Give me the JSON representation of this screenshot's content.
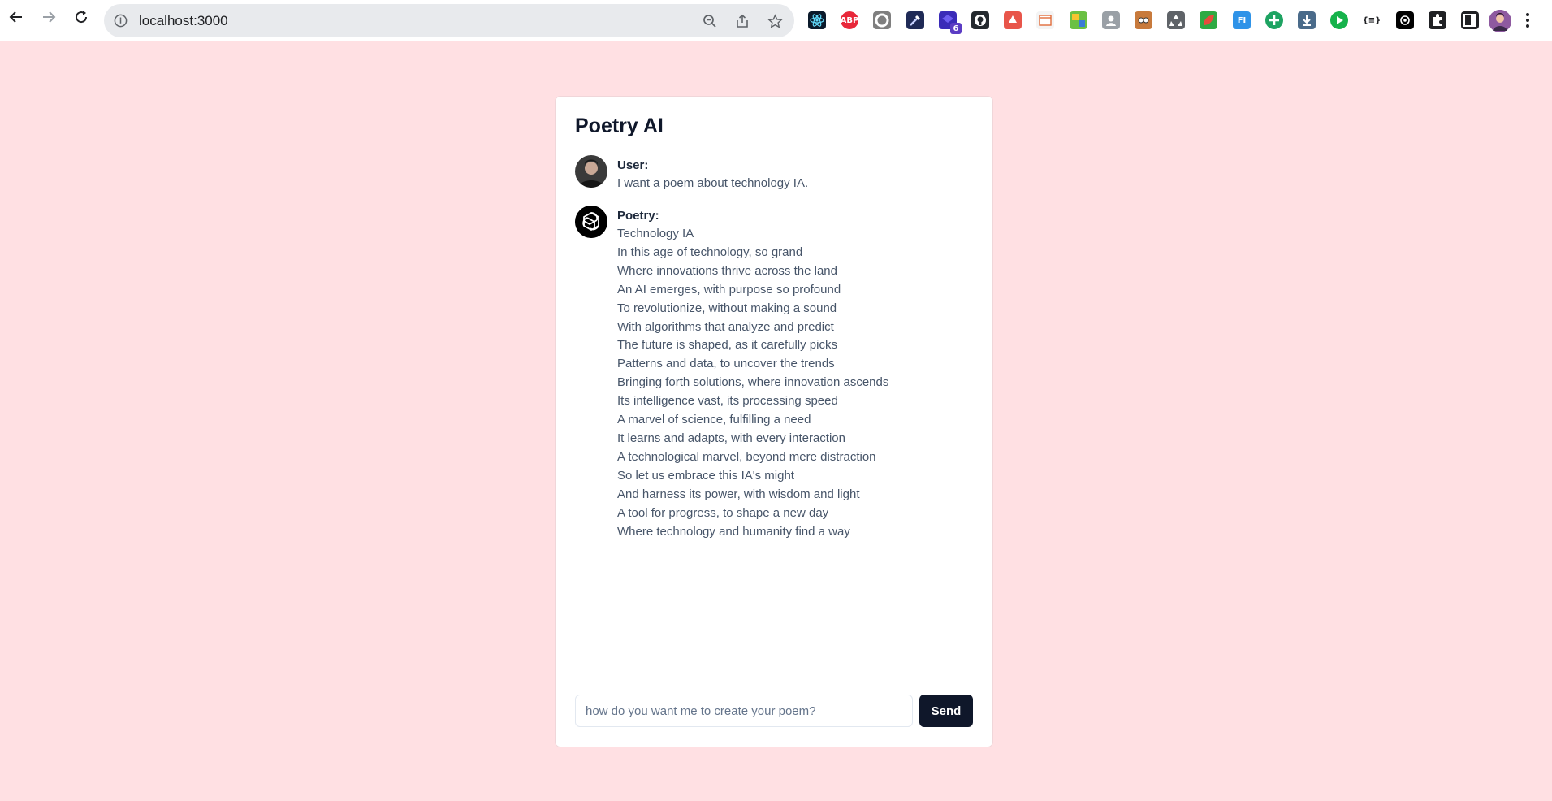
{
  "browser": {
    "url": "localhost:3000",
    "extension_badge": "6",
    "extensions": [
      {
        "name": "react-devtools-icon",
        "color": "#0b1a2b"
      },
      {
        "name": "adblock-icon",
        "color": "#e8273a",
        "label": "ABP"
      },
      {
        "name": "circle-extension-icon",
        "color": "#7f7f7f"
      },
      {
        "name": "eyedropper-icon",
        "color": "#1f2a56"
      },
      {
        "name": "extension-stack-icon",
        "color": "#3a2bb8"
      },
      {
        "name": "github-icon",
        "color": "#24292e"
      },
      {
        "name": "tree-extension-icon",
        "color": "#e8554a"
      },
      {
        "name": "notes-extension-icon",
        "color": "#f4f4f4"
      },
      {
        "name": "colorzilla-icon",
        "color": "#6ac043"
      },
      {
        "name": "photo-extension-icon",
        "color": "#9aa0a6"
      },
      {
        "name": "face-extension-icon",
        "color": "#c87a3c"
      },
      {
        "name": "recycle-icon",
        "color": "#5f6368"
      },
      {
        "name": "leaf-extension-icon",
        "color": "#2eaa43"
      },
      {
        "name": "fi-extension-icon",
        "color": "#2f93e8",
        "label": "FI"
      },
      {
        "name": "plus-extension-icon",
        "color": "#1ea362"
      },
      {
        "name": "download-extension-icon",
        "color": "#4a6b8a"
      },
      {
        "name": "play-extension-icon",
        "color": "#16b24b"
      },
      {
        "name": "json-extension-icon",
        "color": "#ffffff",
        "label": "{≡}"
      },
      {
        "name": "chatgpt-extension-icon",
        "color": "#000000"
      },
      {
        "name": "puzzle-icon",
        "color": "#202124"
      },
      {
        "name": "sidepanel-icon",
        "color": "#202124"
      }
    ]
  },
  "app": {
    "title": "Poetry AI",
    "messages": [
      {
        "speaker": "User:",
        "text": "I want a poem about technology IA."
      },
      {
        "speaker": "Poetry:",
        "lines": [
          "Technology IA",
          "In this age of technology, so grand",
          "Where innovations thrive across the land",
          "An AI emerges, with purpose so profound",
          "To revolutionize, without making a sound",
          "With algorithms that analyze and predict",
          "The future is shaped, as it carefully picks",
          "Patterns and data, to uncover the trends",
          "Bringing forth solutions, where innovation ascends",
          "Its intelligence vast, its processing speed",
          "A marvel of science, fulfilling a need",
          "It learns and adapts, with every interaction",
          "A technological marvel, beyond mere distraction",
          "So let us embrace this IA's might",
          "And harness its power, with wisdom and light",
          "A tool for progress, to shape a new day",
          "Where technology and humanity find a way"
        ]
      }
    ],
    "composer": {
      "placeholder": "how do you want me to create your poem?",
      "value": "",
      "send_label": "Send"
    }
  },
  "colors": {
    "page_background": "#ffe0e3",
    "card_background": "#ffffff",
    "button_background": "#0f172a",
    "text_muted": "#475569"
  }
}
